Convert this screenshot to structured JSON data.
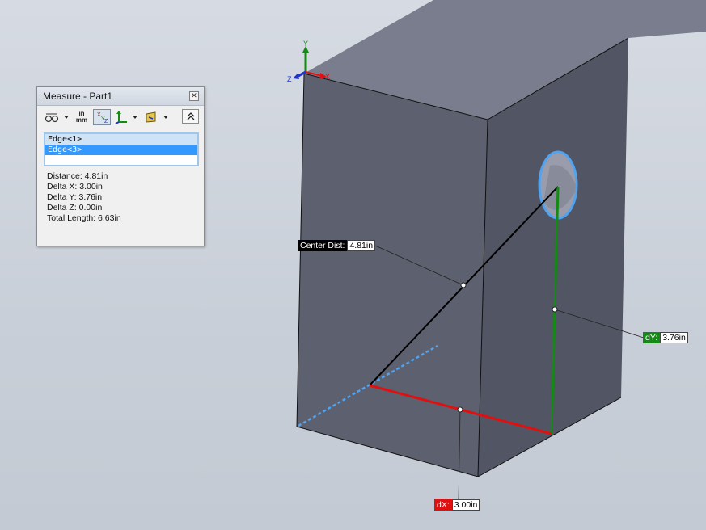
{
  "panel": {
    "title": "Measure - Part1",
    "close_icon": "close-icon",
    "toolbar": {
      "arc_circle_icon": "arc-circle-measure-icon",
      "units_line1": "in",
      "units_line2": "mm",
      "xyz_icon": "xyz-measure-icon",
      "point_to_point_icon": "point-to-point-icon",
      "projection_icon": "projection-icon",
      "collapse_icon": "collapse-up-icon"
    },
    "selections": [
      "Edge<1>",
      "Edge<3>"
    ],
    "results": [
      "Distance: 4.81in",
      "Delta X: 3.00in",
      "Delta Y: 3.76in",
      "Delta Z: 0.00in",
      "Total Length: 6.63in"
    ]
  },
  "triad": {
    "x": "X",
    "y": "Y",
    "z": "Z"
  },
  "callouts": {
    "center": {
      "label": "Center Dist:",
      "value": "4.81in"
    },
    "dy": {
      "label": "dY:",
      "value": "3.76in"
    },
    "dx": {
      "label": "dX:",
      "value": "3.00in"
    }
  },
  "colors": {
    "dx": "#e01010",
    "dy": "#138a13",
    "highlight": "#4fa3f0",
    "face_front": "#5c5f6d",
    "face_top": "#797c8d",
    "face_side": "#545765"
  }
}
